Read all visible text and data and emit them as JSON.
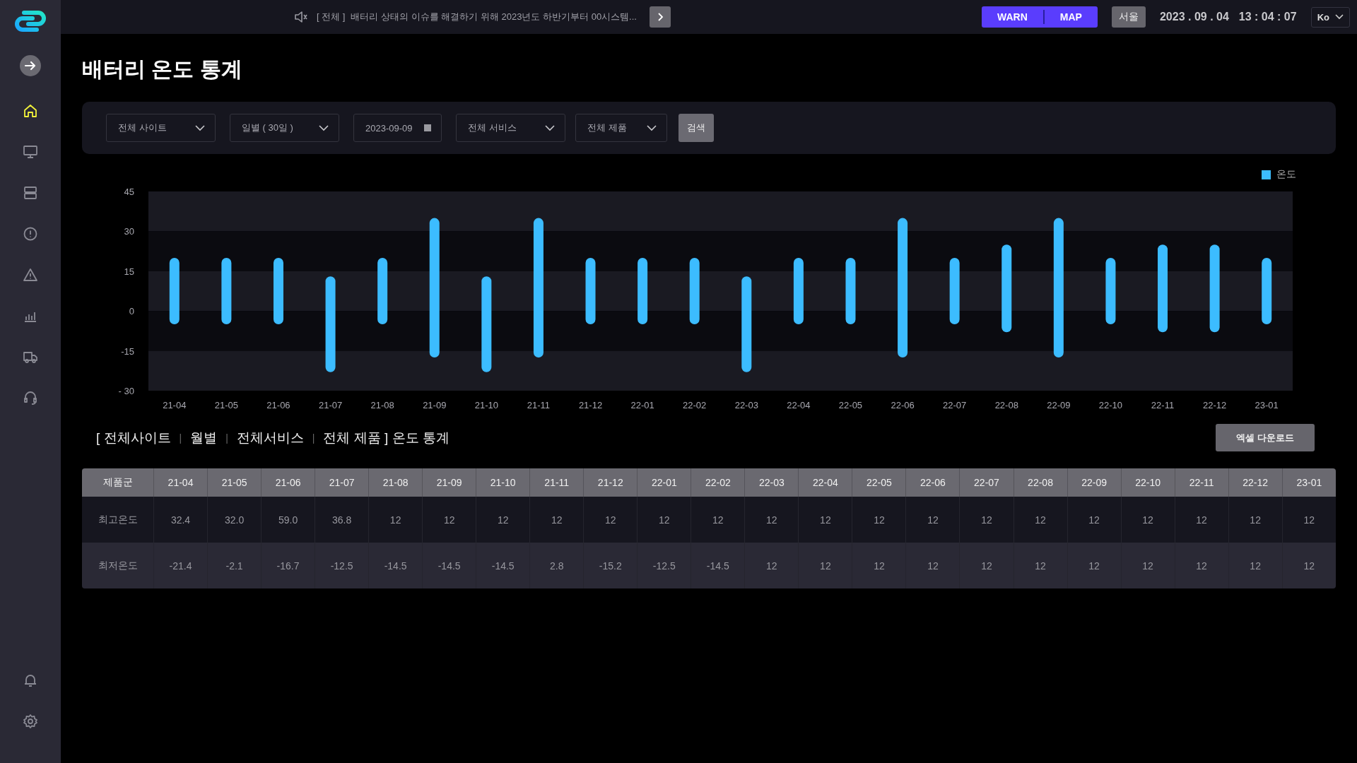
{
  "sidebar": {
    "nav": [
      {
        "kind": "home",
        "selected": true
      },
      {
        "kind": "monitor",
        "selected": false
      },
      {
        "kind": "server",
        "selected": false
      },
      {
        "kind": "alert",
        "selected": false
      },
      {
        "kind": "warning",
        "selected": false
      },
      {
        "kind": "chart",
        "selected": false
      },
      {
        "kind": "truck",
        "selected": false
      },
      {
        "kind": "headset",
        "selected": false
      }
    ],
    "bottom": [
      {
        "kind": "bell"
      },
      {
        "kind": "settings"
      }
    ]
  },
  "topbar": {
    "notice_tag": "[ 전체 ]",
    "notice": "배터리 상태의 이슈를 해결하기 위해 2023년도 하반기부터 00시스템...",
    "mode_buttons": [
      "WARN",
      "MAP"
    ],
    "region": "서울",
    "date": "2023 . 09 . 04",
    "time": "13 : 04 : 07",
    "language": "Ko"
  },
  "page_title": "배터리 온도 통계",
  "filters": [
    {
      "kind": "select",
      "value": "전체 사이트"
    },
    {
      "kind": "select",
      "value": "일별 ( 30일 )"
    },
    {
      "kind": "date",
      "value": "2023-09-09"
    },
    {
      "kind": "select",
      "value": "전체 서비스"
    },
    {
      "kind": "select",
      "value": "전체 제품"
    }
  ],
  "search_button": "검색",
  "chart": {
    "chart_data": {
      "type": "candlestick",
      "categories": [
        "21-04",
        "21-05",
        "21-06",
        "21-07",
        "21-08",
        "21-09",
        "21-10",
        "21-11",
        "21-12",
        "22-01",
        "22-02",
        "22-03",
        "22-04",
        "22-05",
        "22-06",
        "22-07",
        "22-08",
        "22-09",
        "22-10",
        "22-11",
        "22-12",
        "23-01"
      ],
      "series": [
        {
          "name": "온도",
          "color": "#3cbcff",
          "ohlc": [
            [
              -5,
              20,
              -5,
              20
            ],
            [
              -5,
              20,
              -5,
              20
            ],
            [
              -5,
              20,
              -5,
              20
            ],
            [
              -23,
              13,
              -23,
              13
            ],
            [
              -5,
              20,
              -5,
              20
            ],
            [
              -17.5,
              35,
              -17.5,
              35
            ],
            [
              -23,
              13,
              -23,
              13
            ],
            [
              -17.5,
              35,
              -17.5,
              35
            ],
            [
              -5,
              20,
              -5,
              20
            ],
            [
              -5,
              20,
              -5,
              20
            ],
            [
              -5,
              20,
              -5,
              20
            ],
            [
              -23,
              13,
              -23,
              13
            ],
            [
              -5,
              20,
              -5,
              20
            ],
            [
              -5,
              20,
              -5,
              20
            ],
            [
              -17.5,
              35,
              -17.5,
              35
            ],
            [
              -5,
              20,
              -5,
              20
            ],
            [
              -8,
              25,
              -8,
              25
            ],
            [
              -17.5,
              35,
              -17.5,
              35
            ],
            [
              -5,
              20,
              -5,
              20
            ],
            [
              -8,
              25,
              -8,
              25
            ],
            [
              -8,
              25,
              -8,
              25
            ],
            [
              -5,
              20,
              -5,
              20
            ]
          ]
        }
      ],
      "ylim": [
        -30,
        45
      ],
      "yticks": [
        45,
        30,
        15,
        0,
        -15,
        {
          "value": -30,
          "label": "- 30"
        }
      ]
    }
  },
  "summary": {
    "separator": "|",
    "parts": [
      "[ 전체사이트",
      "월별",
      "전체서비스",
      "전체 제품 ] 온도 통계"
    ]
  },
  "excel_button": "엑셀 다운로드",
  "table": {
    "columns": [
      "제품군",
      "21-04",
      "21-05",
      "21-06",
      "21-07",
      "21-08",
      "21-09",
      "21-10",
      "21-11",
      "21-12",
      "22-01",
      "22-02",
      "22-03",
      "22-04",
      "22-05",
      "22-06",
      "22-07",
      "22-08",
      "22-09",
      "22-10",
      "22-11",
      "22-12",
      "23-01"
    ],
    "rows": [
      [
        "최고온도",
        "32.4",
        "32.0",
        "59.0",
        "36.8",
        "12",
        "12",
        "12",
        "12",
        "12",
        "12",
        "12",
        "12",
        "12",
        "12",
        "12",
        "12",
        "12",
        "12",
        "12",
        "12",
        "12",
        "12"
      ],
      [
        "최저온도",
        "-21.4",
        "-2.1",
        "-16.7",
        "-12.5",
        "-14.5",
        "-14.5",
        "-14.5",
        "2.8",
        "-15.2",
        "-12.5",
        "-14.5",
        "12",
        "12",
        "12",
        "12",
        "12",
        "12",
        "12",
        "12",
        "12",
        "12",
        "12"
      ]
    ]
  }
}
